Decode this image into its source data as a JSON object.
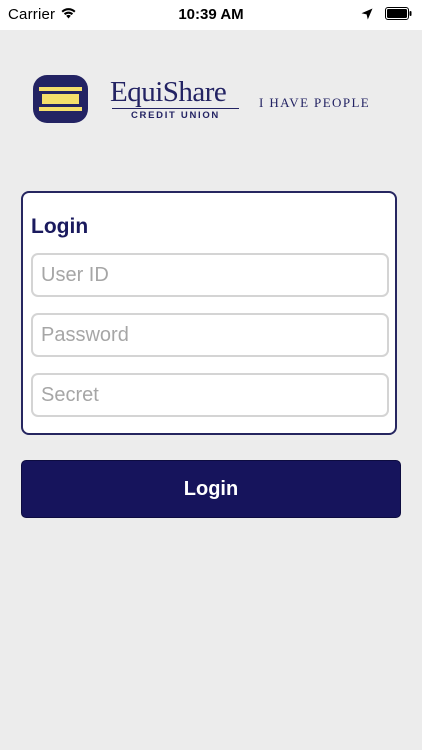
{
  "status_bar": {
    "carrier": "Carrier",
    "time": "10:39 AM",
    "icons": [
      "wifi-icon",
      "location-arrow-icon",
      "battery-icon"
    ]
  },
  "branding": {
    "name": "EquiShare",
    "subtitle": "CREDIT UNION",
    "tagline": "I HAVE PEOPLE",
    "colors": {
      "navy": "#232363",
      "gold": "#f5df6b"
    }
  },
  "login_form": {
    "title": "Login",
    "user_id": {
      "value": "",
      "placeholder": "User ID"
    },
    "password": {
      "value": "",
      "placeholder": "Password"
    },
    "secret": {
      "value": "",
      "placeholder": "Secret"
    }
  },
  "login_button": {
    "label": "Login",
    "color": "#16145c"
  }
}
